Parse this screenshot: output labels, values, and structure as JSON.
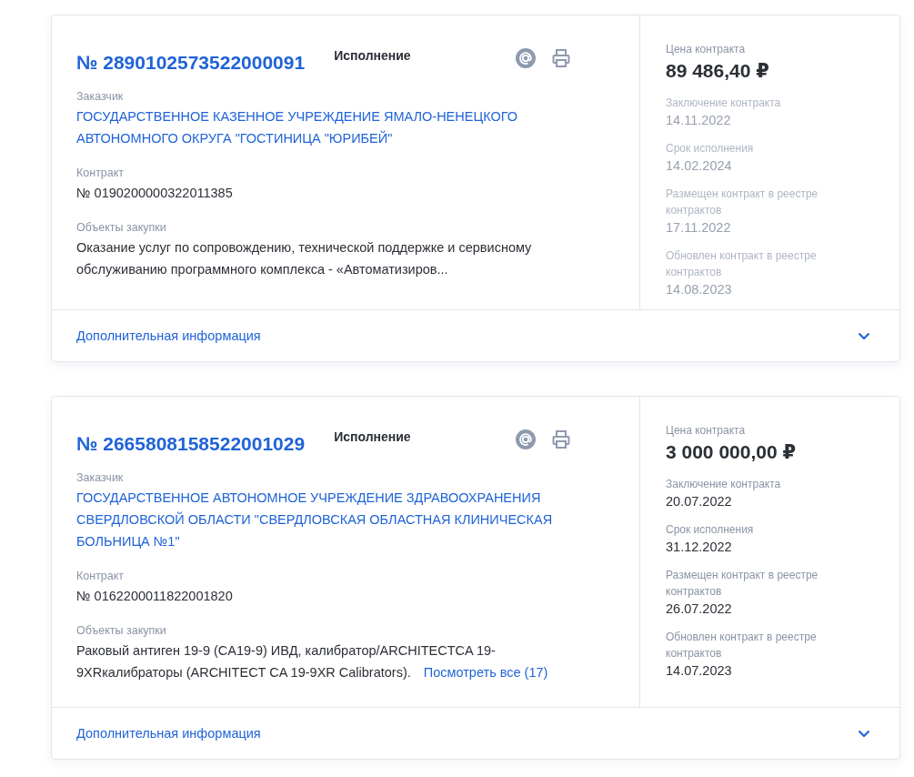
{
  "cards": [
    {
      "number": "№ 2890102573522000091",
      "status": "Исполнение",
      "customer_label": "Заказчик",
      "customer": "ГОСУДАРСТВЕННОЕ КАЗЕННОЕ УЧРЕЖДЕНИЕ ЯМАЛО-НЕНЕЦКОГО АВТОНОМНОГО ОКРУГА \"ГОСТИНИЦА \"ЮРИБЕЙ\"",
      "contract_label": "Контракт",
      "contract": "№ 0190200000322011385",
      "objects_label": "Объекты закупки",
      "objects": "Оказание услуг по сопровождению, технической поддержке и сервисному обслуживанию программного комплекса - «Автоматизиров...",
      "price_label": "Цена контракта",
      "price": "89 486,40 ₽",
      "details_faded": true,
      "details": [
        {
          "label": "Заключение контракта",
          "value": "14.11.2022"
        },
        {
          "label": "Срок исполнения",
          "value": "14.02.2024"
        },
        {
          "label": "Размещен контракт в реестре контрактов",
          "value": "17.11.2022"
        },
        {
          "label": "Обновлен контракт в реестре контрактов",
          "value": "14.08.2023"
        }
      ],
      "more_info": "Дополнительная информация",
      "expanded": false
    },
    {
      "number": "№ 2665808158522001029",
      "status": "Исполнение",
      "customer_label": "Заказчик",
      "customer": "ГОСУДАРСТВЕННОЕ АВТОНОМНОЕ УЧРЕЖДЕНИЕ ЗДРАВООХРАНЕНИЯ СВЕРДЛОВСКОЙ ОБЛАСТИ \"СВЕРДЛОВСКАЯ ОБЛАСТНАЯ КЛИНИЧЕСКАЯ БОЛЬНИЦА №1\"",
      "contract_label": "Контракт",
      "contract": "№ 0162200011822001820",
      "objects_label": "Объекты закупки",
      "objects": "Раковый антиген 19-9 (CA19-9) ИВД, калибратор/ARCHITECTCA 19-9XRкалибраторы (ARCHITECT CA 19-9XR Calibrators).",
      "view_all": "Посмотреть все (17)",
      "price_label": "Цена контракта",
      "price": "3 000 000,00 ₽",
      "details_faded": false,
      "details": [
        {
          "label": "Заключение контракта",
          "value": "20.07.2022"
        },
        {
          "label": "Срок исполнения",
          "value": "31.12.2022"
        },
        {
          "label": "Размещен контракт в реестре контрактов",
          "value": "26.07.2022"
        },
        {
          "label": "Обновлен контракт в реестре контрактов",
          "value": "14.07.2023"
        }
      ],
      "more_info": "Дополнительная информация",
      "expanded": false
    }
  ]
}
